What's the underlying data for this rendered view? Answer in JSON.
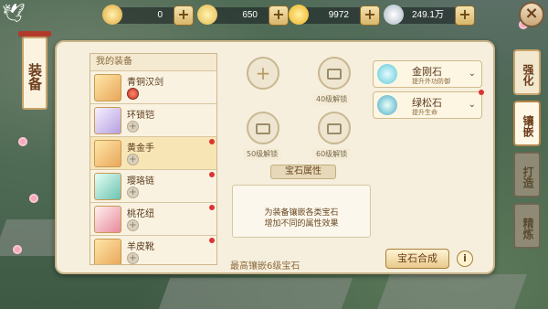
{
  "top": {
    "copper": {
      "value": "0",
      "icon": "copper-ingot-icon"
    },
    "gold": {
      "value": "650",
      "icon": "gold-coin-icon"
    },
    "jade": {
      "value": "9972",
      "icon": "smile-coin-icon"
    },
    "silver": {
      "value": "249.1万",
      "icon": "silver-coin-icon"
    },
    "plus": "+"
  },
  "left_tag": "装备",
  "list": {
    "header": "我的装备",
    "items": [
      {
        "name": "青铜汉剑",
        "badge": "",
        "selected": false
      },
      {
        "name": "环锁铠",
        "badge": "",
        "selected": false
      },
      {
        "name": "黄金手",
        "badge": "",
        "selected": true
      },
      {
        "name": "璎珞链",
        "badge": "",
        "selected": false
      },
      {
        "name": "桃花纽",
        "badge": "",
        "selected": false
      },
      {
        "name": "羊皮靴",
        "badge": "",
        "selected": false
      }
    ]
  },
  "slots": {
    "add": "+",
    "lvl40": "40级解锁",
    "lvl50": "50级解锁",
    "lvl60": "60级解锁"
  },
  "attr": {
    "title": "宝石属性",
    "line1": "为装备镶嵌各类宝石",
    "line2": "增加不同的属性效果"
  },
  "max": "最高镶嵌6级宝石",
  "merge_btn": "宝石合成",
  "info": "i",
  "gems": [
    {
      "name": "金刚石",
      "desc": "提升外功防御"
    },
    {
      "name": "绿松石",
      "desc": "提升生命"
    }
  ],
  "tabs": [
    "强化",
    "镶嵌",
    "打造",
    "精炼"
  ],
  "close": "×",
  "colors": {
    "accent": "#c9a46b",
    "red_dot": "#dd3333"
  }
}
